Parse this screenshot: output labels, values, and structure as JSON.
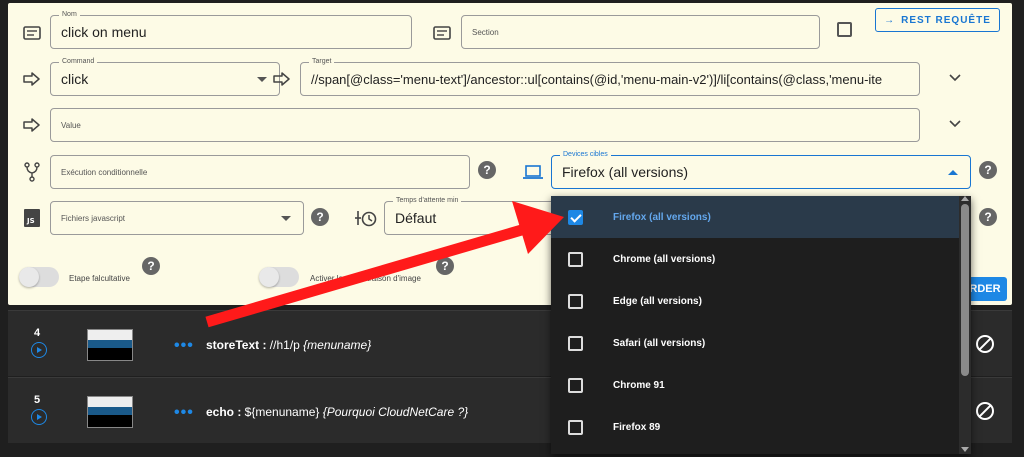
{
  "form": {
    "nom": {
      "label": "Nom",
      "value": "click on menu"
    },
    "section": {
      "placeholder": "Section"
    },
    "rest_button": "REST REQUÊTE",
    "command": {
      "label": "Command",
      "value": "click"
    },
    "target": {
      "label": "Target",
      "value": "//span[@class='menu-text']/ancestor::ul[contains(@id,'menu-main-v2')]/li[contains(@class,'menu-ite"
    },
    "value": {
      "placeholder": "Value"
    },
    "exec_cond": {
      "placeholder": "Exécution conditionnelle"
    },
    "devices": {
      "label": "Devices cibles",
      "value": "Firefox (all versions)"
    },
    "js_files": {
      "placeholder": "Fichiers javascript"
    },
    "wait_time": {
      "label": "Temps d'attente min",
      "value": "Défaut"
    },
    "toggle_optional": "Etape falcultative",
    "toggle_image": "Activer la comparaison d'image",
    "save_button": "RDER",
    "help_glyph": "?"
  },
  "steps": [
    {
      "num": "4",
      "dots": "•••",
      "cmd": "storeText : ",
      "arg": "//h1/p ",
      "var": "{menuname}"
    },
    {
      "num": "5",
      "dots": "•••",
      "cmd": "echo : ",
      "arg": "${menuname} ",
      "var": "{Pourquoi CloudNetCare ?}"
    }
  ],
  "dropdown": {
    "items": [
      {
        "label": "Firefox (all versions)",
        "checked": true
      },
      {
        "label": "Chrome (all versions)",
        "checked": false
      },
      {
        "label": "Edge (all versions)",
        "checked": false
      },
      {
        "label": "Safari (all versions)",
        "checked": false
      },
      {
        "label": "Chrome 91",
        "checked": false
      },
      {
        "label": "Firefox 89",
        "checked": false
      }
    ]
  },
  "colors": {
    "panel_bg": "#fdfbe6",
    "accent": "#1976d2",
    "arrow": "#ff1a1a",
    "dark_bg": "#1f1f1f"
  },
  "icons": {
    "nom": "text-field-icon",
    "section": "text-field-icon",
    "command": "arrow-right-icon",
    "target": "arrow-right-icon",
    "value": "arrow-right-icon",
    "exec_cond": "fork-icon",
    "devices": "laptop-icon",
    "js": "js-file-icon",
    "wait": "timer-icon"
  }
}
